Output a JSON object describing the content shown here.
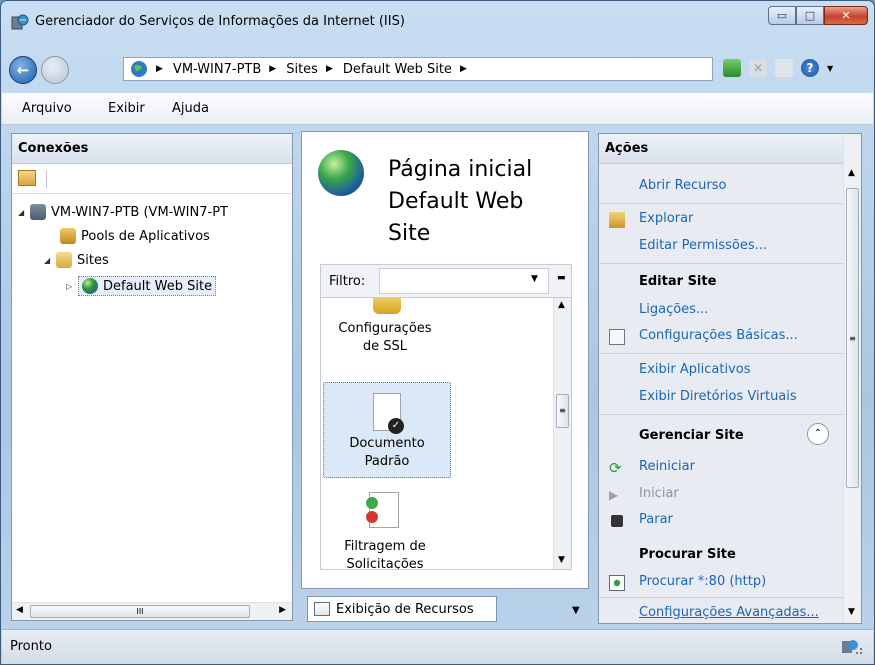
{
  "window": {
    "title": "Gerenciador do Serviços de Informações da Internet (IIS)",
    "caption_buttons": {
      "minimize": "▭",
      "maximize": "□",
      "close": "✕"
    }
  },
  "address_bar": {
    "crumbs": [
      "VM-WIN7-PTB",
      "Sites",
      "Default Web Site"
    ]
  },
  "menu": {
    "items": [
      "Arquivo",
      "Exibir",
      "Ajuda"
    ]
  },
  "connections": {
    "header": "Conexões",
    "tree": {
      "server": "VM-WIN7-PTB (VM-WIN7-PT",
      "app_pools": "Pools de Aplicativos",
      "sites": "Sites",
      "default_site": "Default Web Site"
    },
    "scroll_thumb_mark": "III"
  },
  "home": {
    "title_line1": "Página inicial",
    "title_line2": "Default Web",
    "title_line3": "Site",
    "filter_label": "Filtro:",
    "features": [
      {
        "line1": "Configurações",
        "line2": "de SSL"
      },
      {
        "line1": "Documento",
        "line2": "Padrão"
      },
      {
        "line1": "Filtragem de",
        "line2": "Solicitações"
      }
    ],
    "view_tab": "Exibição de Recursos"
  },
  "actions": {
    "header": "Ações",
    "open_feature": "Abrir Recurso",
    "explore": "Explorar",
    "edit_permissions": "Editar Permissões...",
    "edit_site_head": "Editar Site",
    "bindings": "Ligações...",
    "basic_settings": "Configurações Básicas...",
    "view_apps": "Exibir Aplicativos",
    "view_vdirs": "Exibir Diretórios Virtuais",
    "manage_site_head": "Gerenciar Site",
    "restart": "Reiniciar",
    "start": "Iniciar",
    "stop": "Parar",
    "browse_head": "Procurar Site",
    "browse_80": "Procurar *:80 (http)",
    "advanced_settings": "Configurações Avançadas..."
  },
  "status": {
    "text": "Pronto"
  },
  "colors": {
    "link": "#1c65b3",
    "accent": "#3a5b7d"
  }
}
